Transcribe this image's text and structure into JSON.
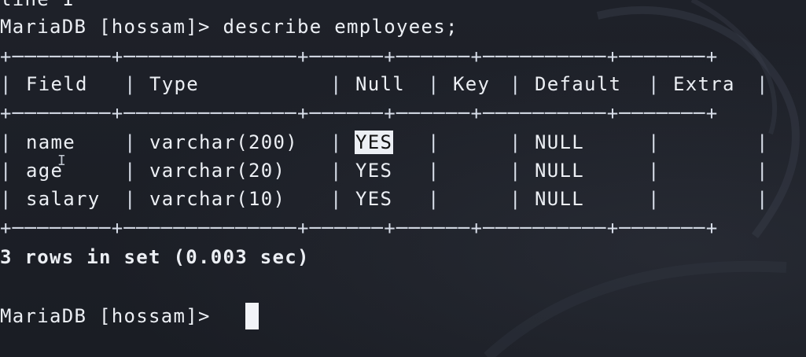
{
  "terminal": {
    "partial_top_line": "line 1",
    "prompt": "MariaDB [hossam]>",
    "command": "describe employees;",
    "columns": [
      "Field",
      "Type",
      "Null",
      "Key",
      "Default",
      "Extra"
    ],
    "rows": [
      {
        "field": "name",
        "type": "varchar(200)",
        "null": "YES",
        "key": "",
        "default": "NULL",
        "extra": ""
      },
      {
        "field": "age",
        "type": "varchar(20)",
        "null": "YES",
        "key": "",
        "default": "NULL",
        "extra": ""
      },
      {
        "field": "salary",
        "type": "varchar(10)",
        "null": "YES",
        "key": "",
        "default": "NULL",
        "extra": ""
      }
    ],
    "summary": "3 rows in set (0.003 sec)",
    "final_prompt": "MariaDB [hossam]>",
    "selected_text": "YES"
  }
}
